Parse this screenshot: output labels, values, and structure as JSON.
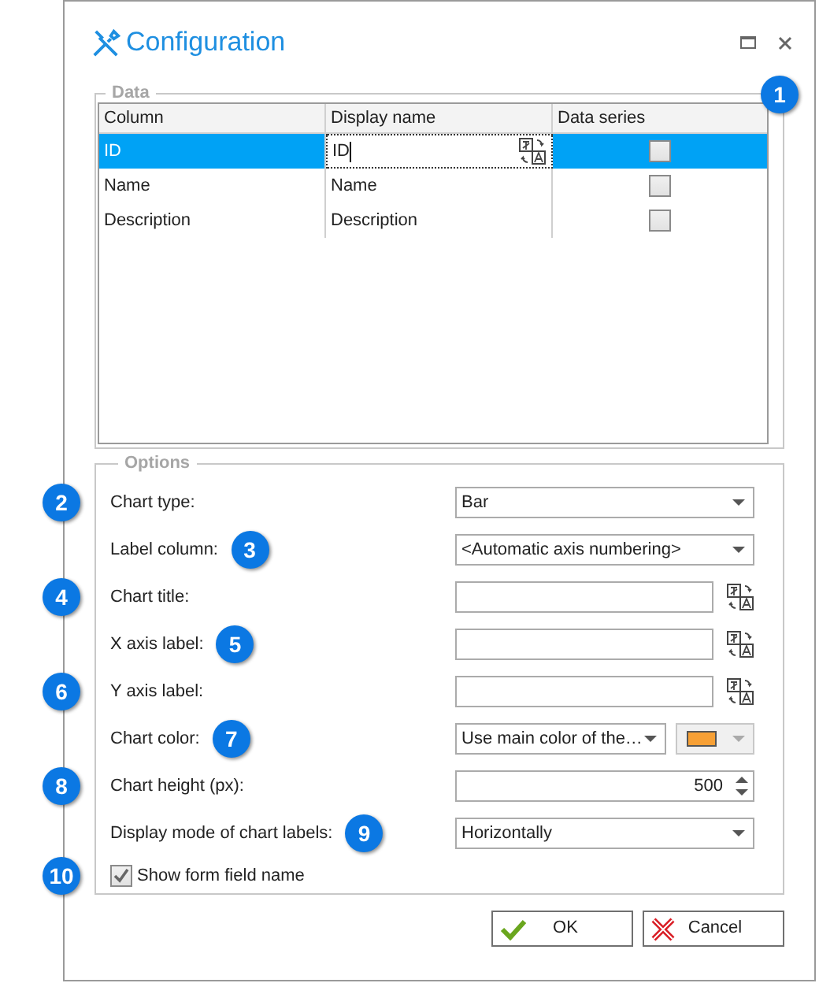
{
  "window": {
    "title": "Configuration"
  },
  "data": {
    "legend": "Data",
    "callout": "1",
    "columns": [
      "Column",
      "Display name",
      "Data series"
    ],
    "rows": [
      {
        "column": "ID",
        "display_name": "ID",
        "data_series": false,
        "selected": true
      },
      {
        "column": "Name",
        "display_name": "Name",
        "data_series": false,
        "selected": false
      },
      {
        "column": "Description",
        "display_name": "Description",
        "data_series": false,
        "selected": false
      }
    ]
  },
  "options": {
    "legend": "Options",
    "rows": [
      {
        "kind": "select",
        "label": "Chart type:",
        "value": "Bar",
        "callout": {
          "text": "2",
          "kind": "margin"
        }
      },
      {
        "kind": "select",
        "label": "Label column:",
        "value": "<Automatic axis numbering>",
        "callout": {
          "text": "3",
          "kind": "inline"
        }
      },
      {
        "kind": "text",
        "label": "Chart title:",
        "callout": {
          "text": "4",
          "kind": "margin"
        }
      },
      {
        "kind": "text",
        "label": "X axis label:",
        "callout": {
          "text": "5",
          "kind": "inline"
        }
      },
      {
        "kind": "text",
        "label": "Y axis label:",
        "callout": {
          "text": "6",
          "kind": "margin"
        }
      },
      {
        "kind": "color",
        "label": "Chart color:",
        "value": "Use main color of the…",
        "color": "#f7a035",
        "callout": {
          "text": "7",
          "kind": "inline"
        }
      },
      {
        "kind": "spinner",
        "label": "Chart height (px):",
        "value": "500",
        "callout": {
          "text": "8",
          "kind": "margin"
        }
      },
      {
        "kind": "select",
        "label": "Display mode of chart labels:",
        "value": "Horizontally",
        "callout": {
          "text": "9",
          "kind": "inline"
        }
      },
      {
        "kind": "checkbox",
        "label": "Show form field name",
        "checked": true,
        "callout": {
          "text": "10",
          "kind": "margin"
        }
      }
    ]
  },
  "buttons": [
    {
      "kind": "ok",
      "label": "OK"
    },
    {
      "kind": "cancel",
      "label": "Cancel"
    }
  ]
}
